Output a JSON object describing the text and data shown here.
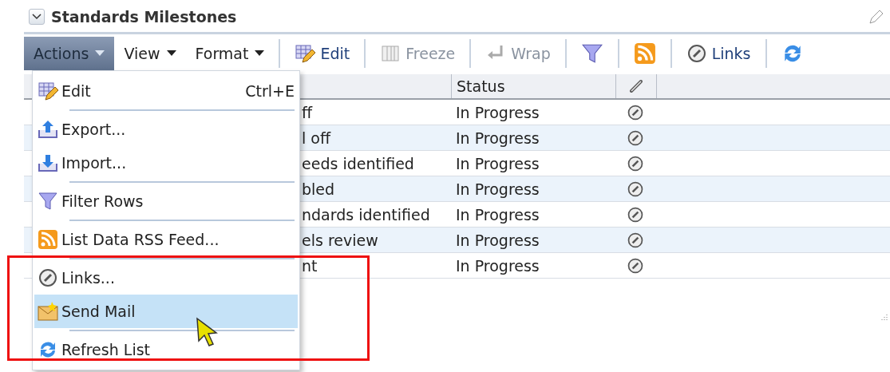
{
  "panel": {
    "title": "Standards Milestones",
    "expanded": true
  },
  "toolbar": [
    {
      "kind": "menu",
      "label": "Actions",
      "selected": true
    },
    {
      "kind": "menu",
      "label": "View",
      "selected": false
    },
    {
      "kind": "menu",
      "label": "Format",
      "selected": false
    },
    {
      "kind": "button",
      "label": "Edit",
      "disabled": false
    },
    {
      "kind": "button",
      "label": "Freeze",
      "disabled": true
    },
    {
      "kind": "button",
      "label": "Wrap",
      "disabled": true
    },
    {
      "kind": "icon"
    },
    {
      "kind": "icon"
    },
    {
      "kind": "button",
      "label": "Links",
      "disabled": false
    },
    {
      "kind": "icon"
    }
  ],
  "table": {
    "columns": [
      {
        "label": "Status"
      }
    ],
    "rows": [
      {
        "column_1": "ff",
        "status": "In Progress"
      },
      {
        "column_1": "l off",
        "status": "In Progress"
      },
      {
        "column_1": "eeds identified",
        "status": "In Progress"
      },
      {
        "column_1": "bled",
        "status": "In Progress"
      },
      {
        "column_1": "ndards identified",
        "status": "In Progress"
      },
      {
        "column_1": "els review",
        "status": "In Progress"
      },
      {
        "column_1": "nt",
        "status": "In Progress"
      }
    ]
  },
  "menu": {
    "items": [
      {
        "label": "Edit",
        "shortcut": "Ctrl+E",
        "selected": false
      },
      {
        "label": "Export...",
        "selected": false
      },
      {
        "label": "Import...",
        "selected": false
      },
      {
        "label": "Filter Rows",
        "selected": false
      },
      {
        "label": "List Data RSS Feed...",
        "selected": false
      },
      {
        "label": "Links...",
        "selected": false
      },
      {
        "label": "Send Mail",
        "selected": true
      },
      {
        "label": "Refresh List",
        "selected": false
      }
    ]
  }
}
